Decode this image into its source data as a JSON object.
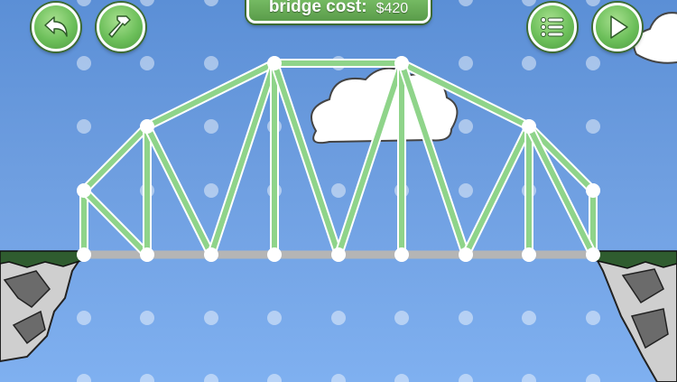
{
  "hud": {
    "cost_label": "bridge cost:",
    "cost_value": "$420"
  },
  "buttons": {
    "undo": "undo-arrow-icon",
    "build": "hammer-icon",
    "menu": "list-menu-icon",
    "play": "play-triangle-icon"
  },
  "colors": {
    "sky": "#6e9ee0",
    "member": "#8fd48a",
    "member_outline": "#ffffff",
    "road": "#b0b0b0",
    "grass": "#2f5c2f",
    "button": "#6cbf5a"
  }
}
